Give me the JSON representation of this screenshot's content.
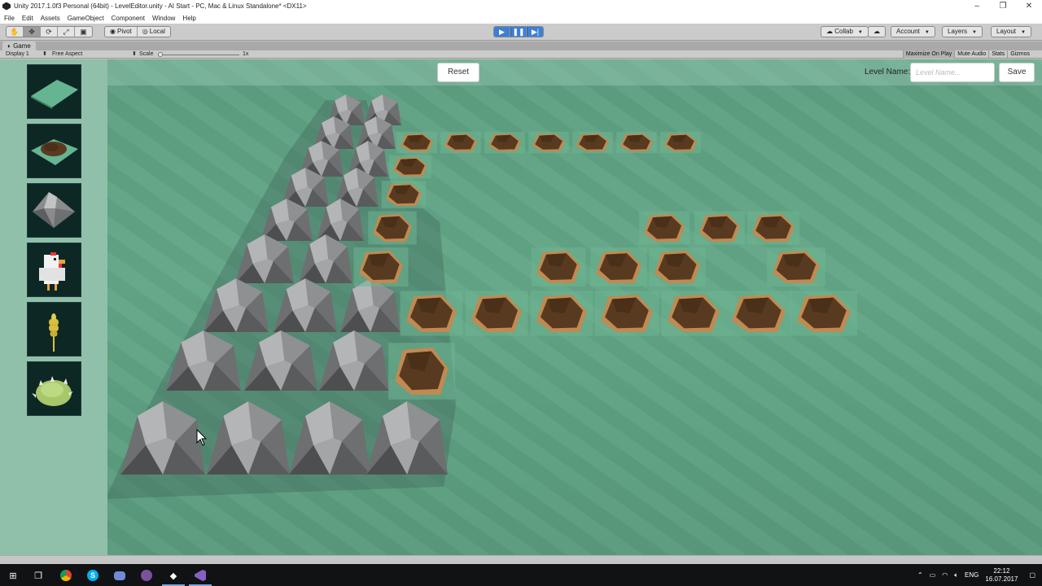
{
  "window": {
    "title": "Unity 2017.1.0f3 Personal (64bit) - LevelEditor.unity - AI Start - PC, Mac & Linux Standalone* <DX11>",
    "controls": [
      "–",
      "❐",
      "✕"
    ]
  },
  "menu": [
    "File",
    "Edit",
    "Assets",
    "GameObject",
    "Component",
    "Window",
    "Help"
  ],
  "toolbar": {
    "pivot_label": "Pivot",
    "local_label": "Local",
    "collab_label": "Collab",
    "account_label": "Account",
    "layers_label": "Layers",
    "layout_label": "Layout"
  },
  "game_panel": {
    "tab_label": "Game",
    "display_label": "Display 1",
    "aspect_label": "Free Aspect",
    "scale_label": "Scale",
    "scale_value": "1x",
    "maximize_label": "Maximize On Play",
    "mute_label": "Mute Audio",
    "stats_label": "Stats",
    "gizmos_label": "Gizmos"
  },
  "ui": {
    "reset_label": "Reset",
    "level_name_label": "Level Name:",
    "level_name_placeholder": "Level Name...",
    "level_name_value": "",
    "save_label": "Save"
  },
  "palette": [
    {
      "name": "grass-tile"
    },
    {
      "name": "dirt-tile"
    },
    {
      "name": "rock-tile"
    },
    {
      "name": "chicken"
    },
    {
      "name": "wheat"
    },
    {
      "name": "bush"
    }
  ],
  "taskbar": {
    "language": "ENG",
    "time": "22:12",
    "date": "16.07.2017"
  },
  "colors": {
    "ground": "#60a385",
    "panel": "#90c0a9",
    "rock": "#8a8b8d",
    "dirt": "#5a3b21",
    "play_blue": "#3d7fd4"
  }
}
